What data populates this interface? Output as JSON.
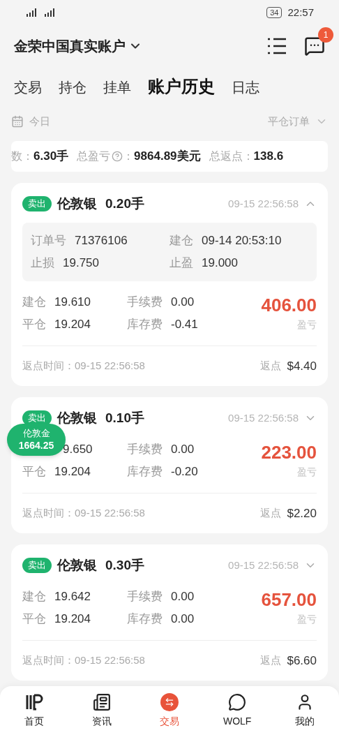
{
  "status_bar": {
    "battery": "34",
    "time": "22:57"
  },
  "header": {
    "account": "金荣中国真实账户",
    "badge": "1"
  },
  "tabs": [
    {
      "label": "交易",
      "selected": false
    },
    {
      "label": "持仓",
      "selected": false
    },
    {
      "label": "挂单",
      "selected": false
    },
    {
      "label": "账户历史",
      "selected": true
    },
    {
      "label": "日志",
      "selected": false
    }
  ],
  "filter": {
    "date": "今日",
    "order_type": "平仓订单"
  },
  "summary": [
    {
      "label": "数",
      "help": false,
      "sep": "：",
      "value": "6.30手"
    },
    {
      "label": "总盈亏",
      "help": true,
      "sep": "：",
      "value": "9864.89美元"
    },
    {
      "label": "总返点",
      "help": false,
      "sep": "：",
      "value": "138.6"
    }
  ],
  "orders": [
    {
      "side": "卖出",
      "symbol": "伦敦银",
      "lots": "0.20手",
      "time": "09-15 22:56:58",
      "expanded": true,
      "details": [
        {
          "label": "订单号",
          "value": "71376106"
        },
        {
          "label": "建仓",
          "value": "09-14 20:53:10"
        },
        {
          "label": "止损",
          "value": "19.750"
        },
        {
          "label": "止盈",
          "value": "19.000"
        }
      ],
      "fields": [
        {
          "label": "建仓",
          "value": "19.610"
        },
        {
          "label": "手续费",
          "value": "0.00"
        },
        {
          "label": "平仓",
          "value": "19.204"
        },
        {
          "label": "库存费",
          "value": "-0.41"
        }
      ],
      "pnl": "406.00",
      "pnl_label": "盈亏",
      "rebate_time_label": "返点时间：",
      "rebate_time": "09-15 22:56:58",
      "rebate_label": "返点",
      "rebate": "$4.40"
    },
    {
      "side": "卖出",
      "symbol": "伦敦银",
      "lots": "0.10手",
      "time": "09-15 22:56:58",
      "expanded": false,
      "fields": [
        {
          "value": "9.650"
        },
        {
          "label": "手续费",
          "value": "0.00"
        },
        {
          "label": "平仓",
          "value": "19.204"
        },
        {
          "label": "库存费",
          "value": "-0.20"
        }
      ],
      "pnl": "223.00",
      "pnl_label": "盈亏",
      "rebate_time_label": "返点时间：",
      "rebate_time": "09-15 22:56:58",
      "rebate_label": "返点",
      "rebate": "$2.20"
    },
    {
      "side": "卖出",
      "symbol": "伦敦银",
      "lots": "0.30手",
      "time": "09-15 22:56:58",
      "expanded": false,
      "fields": [
        {
          "label": "建仓",
          "value": "19.642"
        },
        {
          "label": "手续费",
          "value": "0.00"
        },
        {
          "label": "平仓",
          "value": "19.204"
        },
        {
          "label": "库存费",
          "value": "0.00"
        }
      ],
      "pnl": "657.00",
      "pnl_label": "盈亏",
      "rebate_time_label": "返点时间：",
      "rebate_time": "09-15 22:56:58",
      "rebate_label": "返点",
      "rebate": "$6.60"
    }
  ],
  "floating_quote": {
    "symbol": "伦敦金",
    "price": "1664.25"
  },
  "nav": [
    {
      "kind": "home",
      "label": "首页",
      "selected": false
    },
    {
      "kind": "news",
      "label": "资讯",
      "selected": false
    },
    {
      "kind": "trade",
      "label": "交易",
      "selected": true
    },
    {
      "kind": "wolf",
      "label": "WOLF",
      "selected": false
    },
    {
      "kind": "me",
      "label": "我的",
      "selected": false
    }
  ]
}
